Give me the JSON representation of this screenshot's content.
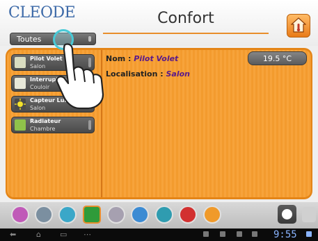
{
  "app": {
    "logo": "CLEODE",
    "title": "Confort"
  },
  "filter": {
    "label": "Toutes"
  },
  "devices": [
    {
      "name": "Pilot Volet",
      "location": "Salon",
      "icon": "shutter-icon",
      "color": "#d9dcc0"
    },
    {
      "name": "Interrupteur",
      "location": "Couloir",
      "icon": "switch-icon",
      "color": "#e7e7d8"
    },
    {
      "name": "Capteur Lumiere",
      "location": "Salon",
      "icon": "light-sensor-icon",
      "color": "#f4e22a"
    },
    {
      "name": "Radiateur",
      "location": "Chambre",
      "icon": "radiator-icon",
      "color": "#8fc24a"
    }
  ],
  "details": {
    "name_label": "Nom : ",
    "name_value": "Pilot Volet",
    "location_label": "Localisation : ",
    "location_value": "Salon",
    "temperature": "19.5 °C"
  },
  "dock": {
    "icons": [
      {
        "name": "media-icon",
        "color": "#c05ab8"
      },
      {
        "name": "meter-icon",
        "color": "#7b8fa0"
      },
      {
        "name": "window-icon",
        "color": "#3aa7c8"
      },
      {
        "name": "plug-icon",
        "color": "#2f9b3a"
      },
      {
        "name": "alert-icon",
        "color": "#a6a0b0"
      },
      {
        "name": "user-icon",
        "color": "#3c8bd3"
      },
      {
        "name": "screen-icon",
        "color": "#2f9cb0"
      },
      {
        "name": "alarm-icon",
        "color": "#d23030"
      },
      {
        "name": "person-icon",
        "color": "#f09a2a"
      }
    ],
    "selected": "plug-icon"
  },
  "system": {
    "clock": "9:55"
  },
  "colors": {
    "accent": "#e88d2b",
    "logo": "#3d6aa8",
    "value": "#5a1a8a"
  }
}
